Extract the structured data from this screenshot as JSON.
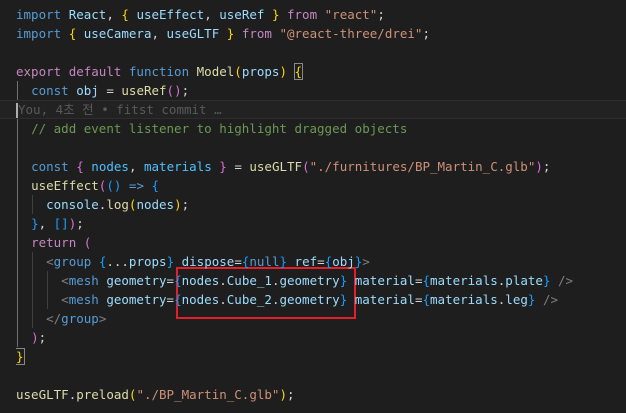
{
  "editor": {
    "blame": "You, 4초 전 • fitst commit …",
    "highlight_color": "#e0202a",
    "lines": [
      {
        "tokens": [
          [
            "kw",
            "import"
          ],
          [
            "p",
            " "
          ],
          [
            "var",
            "React"
          ],
          [
            "p",
            ", "
          ],
          [
            "b1",
            "{"
          ],
          [
            "p",
            " "
          ],
          [
            "var",
            "useEffect"
          ],
          [
            "p",
            ", "
          ],
          [
            "var",
            "useRef"
          ],
          [
            "p",
            " "
          ],
          [
            "b1",
            "}"
          ],
          [
            "p",
            " "
          ],
          [
            "ctl",
            "from"
          ],
          [
            "p",
            " "
          ],
          [
            "str",
            "\"react\""
          ],
          [
            "p",
            ";"
          ]
        ]
      },
      {
        "tokens": [
          [
            "kw",
            "import"
          ],
          [
            "p",
            " "
          ],
          [
            "b1",
            "{"
          ],
          [
            "p",
            " "
          ],
          [
            "var",
            "useCamera"
          ],
          [
            "p",
            ", "
          ],
          [
            "var",
            "useGLTF"
          ],
          [
            "p",
            " "
          ],
          [
            "b1",
            "}"
          ],
          [
            "p",
            " "
          ],
          [
            "ctl",
            "from"
          ],
          [
            "p",
            " "
          ],
          [
            "str",
            "\"@react-three/drei\""
          ],
          [
            "p",
            ";"
          ]
        ]
      },
      {
        "tokens": []
      },
      {
        "tokens": [
          [
            "ctl",
            "export"
          ],
          [
            "p",
            " "
          ],
          [
            "ctl",
            "default"
          ],
          [
            "p",
            " "
          ],
          [
            "kw",
            "function"
          ],
          [
            "p",
            " "
          ],
          [
            "fn",
            "Model"
          ],
          [
            "b1",
            "("
          ],
          [
            "var",
            "props"
          ],
          [
            "b1",
            ")"
          ],
          [
            "p",
            " "
          ],
          [
            "b1m",
            "{"
          ]
        ]
      },
      {
        "tokens": [
          [
            "p",
            "  "
          ],
          [
            "kw",
            "const"
          ],
          [
            "p",
            " "
          ],
          [
            "var",
            "obj"
          ],
          [
            "p",
            " = "
          ],
          [
            "fn",
            "useRef"
          ],
          [
            "b2",
            "()"
          ],
          [
            "p",
            ";"
          ]
        ]
      },
      {
        "tokens": [
          [
            "cursor",
            ""
          ],
          [
            "blame",
            "     You, 4초 전 • fitst commit …"
          ]
        ],
        "active": true
      },
      {
        "tokens": [
          [
            "p",
            "  "
          ],
          [
            "cmt",
            "// add event listener to highlight dragged objects"
          ]
        ]
      },
      {
        "tokens": []
      },
      {
        "tokens": [
          [
            "p",
            "  "
          ],
          [
            "kw",
            "const"
          ],
          [
            "p",
            " "
          ],
          [
            "b2",
            "{"
          ],
          [
            "p",
            " "
          ],
          [
            "const",
            "nodes"
          ],
          [
            "p",
            ", "
          ],
          [
            "const",
            "materials"
          ],
          [
            "p",
            " "
          ],
          [
            "b2",
            "}"
          ],
          [
            "p",
            " = "
          ],
          [
            "fn",
            "useGLTF"
          ],
          [
            "b2",
            "("
          ],
          [
            "str",
            "\"./furnitures/BP_Martin_C.glb\""
          ],
          [
            "b2",
            ")"
          ],
          [
            "p",
            ";"
          ]
        ]
      },
      {
        "tokens": [
          [
            "p",
            "  "
          ],
          [
            "fn",
            "useEffect"
          ],
          [
            "b2",
            "("
          ],
          [
            "b3",
            "()"
          ],
          [
            "p",
            " "
          ],
          [
            "kw",
            "=>"
          ],
          [
            "p",
            " "
          ],
          [
            "b3",
            "{"
          ]
        ]
      },
      {
        "tokens": [
          [
            "p",
            "    "
          ],
          [
            "var",
            "console"
          ],
          [
            "p",
            "."
          ],
          [
            "fn",
            "log"
          ],
          [
            "b1",
            "("
          ],
          [
            "var",
            "nodes"
          ],
          [
            "b1",
            ")"
          ],
          [
            "p",
            ";"
          ]
        ]
      },
      {
        "tokens": [
          [
            "p",
            "  "
          ],
          [
            "b3",
            "}"
          ],
          [
            "p",
            ", "
          ],
          [
            "b3",
            "[]"
          ],
          [
            "b2",
            ")"
          ],
          [
            "p",
            ";"
          ]
        ]
      },
      {
        "tokens": [
          [
            "p",
            "  "
          ],
          [
            "ctl",
            "return"
          ],
          [
            "p",
            " "
          ],
          [
            "b2",
            "("
          ]
        ]
      },
      {
        "tokens": [
          [
            "p",
            "    "
          ],
          [
            "tagp",
            "<"
          ],
          [
            "tag",
            "group"
          ],
          [
            "p",
            " "
          ],
          [
            "b3",
            "{"
          ],
          [
            "p",
            "..."
          ],
          [
            "var",
            "props"
          ],
          [
            "b3",
            "}"
          ],
          [
            "p",
            " "
          ],
          [
            "attr",
            "dispose"
          ],
          [
            "p",
            "="
          ],
          [
            "b3",
            "{"
          ],
          [
            "kw",
            "null"
          ],
          [
            "b3",
            "}"
          ],
          [
            "p",
            " "
          ],
          [
            "attr",
            "ref"
          ],
          [
            "p",
            "="
          ],
          [
            "b3",
            "{"
          ],
          [
            "var",
            "obj"
          ],
          [
            "b3",
            "}"
          ],
          [
            "tagp",
            ">"
          ]
        ]
      },
      {
        "tokens": [
          [
            "p",
            "      "
          ],
          [
            "tagp",
            "<"
          ],
          [
            "tag",
            "mesh"
          ],
          [
            "p",
            " "
          ],
          [
            "attr",
            "geometry"
          ],
          [
            "p",
            "="
          ],
          [
            "b3",
            "{"
          ],
          [
            "var",
            "nodes"
          ],
          [
            "p",
            "."
          ],
          [
            "var",
            "Cube_1"
          ],
          [
            "p",
            "."
          ],
          [
            "var",
            "geometry"
          ],
          [
            "b3",
            "}"
          ],
          [
            "p",
            " "
          ],
          [
            "attr",
            "material"
          ],
          [
            "p",
            "="
          ],
          [
            "b3",
            "{"
          ],
          [
            "var",
            "materials"
          ],
          [
            "p",
            "."
          ],
          [
            "var",
            "plate"
          ],
          [
            "b3",
            "}"
          ],
          [
            "p",
            " "
          ],
          [
            "tagp",
            "/>"
          ]
        ]
      },
      {
        "tokens": [
          [
            "p",
            "      "
          ],
          [
            "tagp",
            "<"
          ],
          [
            "tag",
            "mesh"
          ],
          [
            "p",
            " "
          ],
          [
            "attr",
            "geometry"
          ],
          [
            "p",
            "="
          ],
          [
            "b3",
            "{"
          ],
          [
            "var",
            "nodes"
          ],
          [
            "p",
            "."
          ],
          [
            "var",
            "Cube_2"
          ],
          [
            "p",
            "."
          ],
          [
            "var",
            "geometry"
          ],
          [
            "b3",
            "}"
          ],
          [
            "p",
            " "
          ],
          [
            "attr",
            "material"
          ],
          [
            "p",
            "="
          ],
          [
            "b3",
            "{"
          ],
          [
            "var",
            "materials"
          ],
          [
            "p",
            "."
          ],
          [
            "var",
            "leg"
          ],
          [
            "b3",
            "}"
          ],
          [
            "p",
            " "
          ],
          [
            "tagp",
            "/>"
          ]
        ]
      },
      {
        "tokens": [
          [
            "p",
            "    "
          ],
          [
            "tagp",
            "</"
          ],
          [
            "tag",
            "group"
          ],
          [
            "tagp",
            ">"
          ]
        ]
      },
      {
        "tokens": [
          [
            "p",
            "  "
          ],
          [
            "b2",
            ")"
          ],
          [
            "p",
            ";"
          ]
        ]
      },
      {
        "tokens": [
          [
            "b1m",
            "}"
          ]
        ]
      },
      {
        "tokens": []
      },
      {
        "tokens": [
          [
            "fn",
            "useGLTF"
          ],
          [
            "p",
            "."
          ],
          [
            "fn",
            "preload"
          ],
          [
            "b1",
            "("
          ],
          [
            "str",
            "\"./BP_Martin_C.glb\""
          ],
          [
            "b1",
            ")"
          ],
          [
            "p",
            ";"
          ]
        ]
      }
    ]
  }
}
